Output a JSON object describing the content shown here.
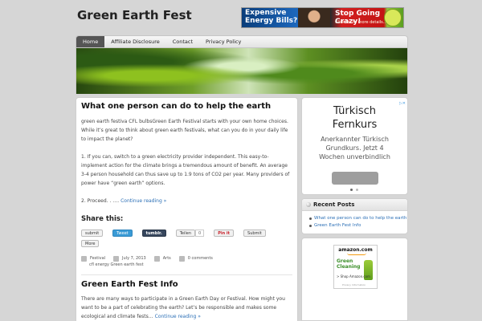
{
  "site": {
    "title": "Green Earth Fest"
  },
  "top_ad": {
    "left_line1": "Expensive",
    "left_line2": "Energy Bills?",
    "right_text": "Stop Going Crazy!",
    "sub_text": "Click for to more details..."
  },
  "nav": {
    "items": [
      {
        "label": "Home",
        "active": true
      },
      {
        "label": "Affiliate Disclosure"
      },
      {
        "label": "Contact"
      },
      {
        "label": "Privacy Policy"
      }
    ]
  },
  "post1": {
    "title": "What one person can do to help the earth",
    "para1": "green earth festiva CFL bulbsGreen Earth Festival starts with your own home choices. While it’s great to think about green earth festivals, what can you do in your daily life to impact the planet?",
    "para2": "1. If you can, switch to a green electricity provider independent. This easy-to-implement action for the climate brings a tremendous amount of benefit. An average 3-4 person household can thus save up to 1.9 tons of CO2 per year. Many providers of power have “green earth” options.",
    "para3_prefix": "2. Proceed. . …. ",
    "continue": "Continue reading »",
    "share_heading": "Share this:",
    "share": {
      "submit": "submit",
      "tweet": "Tweet",
      "tumblr": "tumblr.",
      "teilen": "Teilen",
      "teilen_count": "0",
      "pinit": "Pin it",
      "stumble": "Submit",
      "more": "More"
    },
    "meta": {
      "category": "Festival",
      "date": "July 7, 2013",
      "section": "Arts",
      "comments": "0 comments",
      "tags": "cfl  energy  Green earth fest"
    }
  },
  "post2": {
    "title": "Green Earth Fest Info",
    "text": "There are many ways to participate in a Green Earth Day or Festival. How might you want to be a part of celebrating the earth? Let’s be responsible and makes some ecological and climate fests… ",
    "continue": "Continue reading »"
  },
  "sidebar_ad": {
    "title_line1": "Türkisch",
    "title_line2": "Fernkurs",
    "body_line1": "Anerkannter Türkisch",
    "body_line2": "Grundkurs. Jetzt 4",
    "body_line3": "Wochen unverbindlich"
  },
  "recent_posts": {
    "heading": "Recent Posts",
    "items": [
      "What one person can do to help the earth",
      "Green Earth Fest Info"
    ]
  },
  "amazon_ad": {
    "logo": "amazon.com",
    "line1": "Green",
    "line2": "Cleaning",
    "shop": "> Shop Amazon.com",
    "privacy": "Privacy Information"
  }
}
